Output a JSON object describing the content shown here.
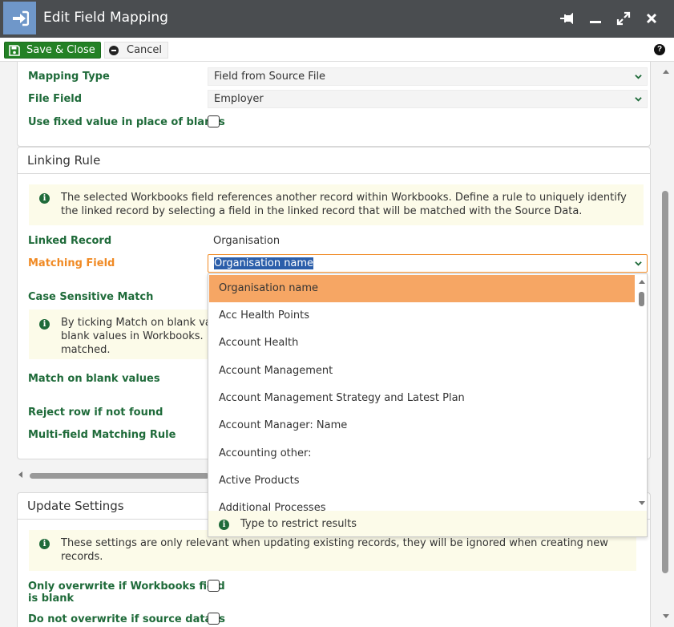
{
  "window": {
    "title": "Edit Field Mapping"
  },
  "toolbar": {
    "save_label": "Save & Close",
    "cancel_label": "Cancel"
  },
  "mapping": {
    "mapping_type_label": "Mapping Type",
    "mapping_type_value": "Field from Source File",
    "file_field_label": "File Field",
    "file_field_value": "Employer",
    "use_fixed_label": "Use fixed value in place of blanks"
  },
  "linking": {
    "heading": "Linking Rule",
    "info": "The selected Workbooks field references another record within Workbooks. Define a rule to uniquely identify the linked record by selecting a field in the linked record that will be matched with the Source Data.",
    "linked_record_label": "Linked Record",
    "linked_record_value": "Organisation",
    "matching_field_label": "Matching Field",
    "matching_field_value": "Organisation name",
    "case_sensitive_label": "Case Sensitive Match",
    "blank_info_1": "By ticking Match on blank va",
    "blank_info_2": "blank values in Workbooks. I",
    "blank_info_3": "matched.",
    "match_blank_label": "Match on blank values",
    "reject_label": "Reject row if not found",
    "multi_field_label": "Multi-field Matching Rule"
  },
  "dropdown": {
    "items": [
      "Organisation name",
      "Acc Health Points",
      "Account Health",
      "Account Management",
      "Account Management Strategy and Latest Plan",
      "Account Manager: Name",
      "Accounting other:",
      "Active Products",
      "Additional Processes"
    ],
    "footer": "Type to restrict results"
  },
  "update": {
    "heading": "Update Settings",
    "info": "These settings are only relevant when updating existing records, they will be ignored when creating new records.",
    "only_overwrite_label_1": "Only overwrite if Workbooks field",
    "only_overwrite_label_2": "is blank",
    "do_not_overwrite_label": "Do not overwrite if source data is"
  },
  "colors": {
    "accent_green": "#1f6b3a",
    "highlight": "#f6a664",
    "save_green": "#238125"
  }
}
